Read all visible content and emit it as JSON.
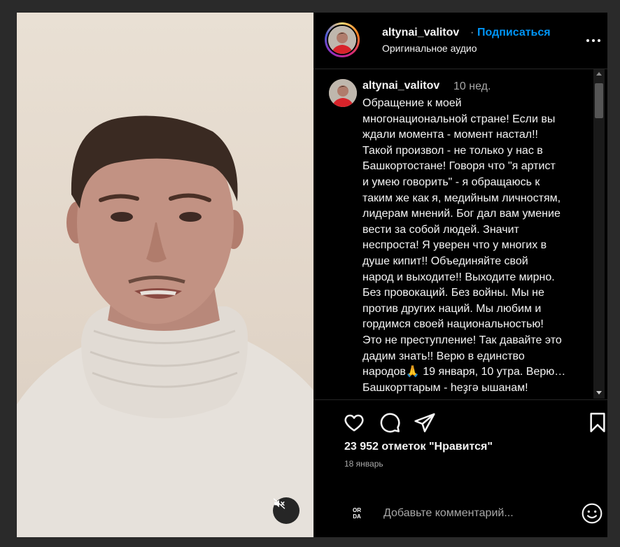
{
  "header": {
    "username": "altynai_valitov",
    "separator": "·",
    "follow_label": "Подписаться",
    "audio_label": "Оригинальное аудио",
    "more_icon": "more-horizontal-icon"
  },
  "caption": {
    "username": "altynai_valitov",
    "time_ago": "10 нед.",
    "text": "Обращение к моей\nмногонациональной стране! Если вы\nждали момента - момент настал!!\nТакой произвол - не только у нас в\nБашкортостане! Говоря что \"я артист\nи умею говорить\" - я обращаюсь к\nтаким же как я, медийным личностям,\nлидерам мнений. Бог дал вам умение\nвести за собой людей. Значит\nнеспроста! Я уверен что у многих в\nдуше кипит!! Объединяйте свой\nнарод и выходите!! Выходите мирно.\nБез провокаций. Без войны. Мы не\nпротив других наций. Мы любим и\nгордимся своей национальностью!\nЭто не преступление! Так давайте это\nдадим знать!! Верю в единство\nнародов🙏 19 января, 10 утра. Верю…\nБашкорттарым - һеҙгә ышанам!"
  },
  "actions": {
    "like_icon": "heart-icon",
    "comment_icon": "comment-icon",
    "share_icon": "send-icon",
    "save_icon": "bookmark-icon"
  },
  "stats": {
    "likes_text": "23 952 отметок \"Нравится\"",
    "date_text": "18 январь"
  },
  "comment_box": {
    "logo_text": "OR DA",
    "placeholder": "Добавьте комментарий...",
    "emoji_icon": "smiley-icon"
  },
  "video": {
    "mute_icon": "muted-speaker-icon"
  },
  "colors": {
    "accent": "#0095f6",
    "background": "#000000",
    "text": "#f5f5f5",
    "secondary_text": "#a8a8a8"
  }
}
